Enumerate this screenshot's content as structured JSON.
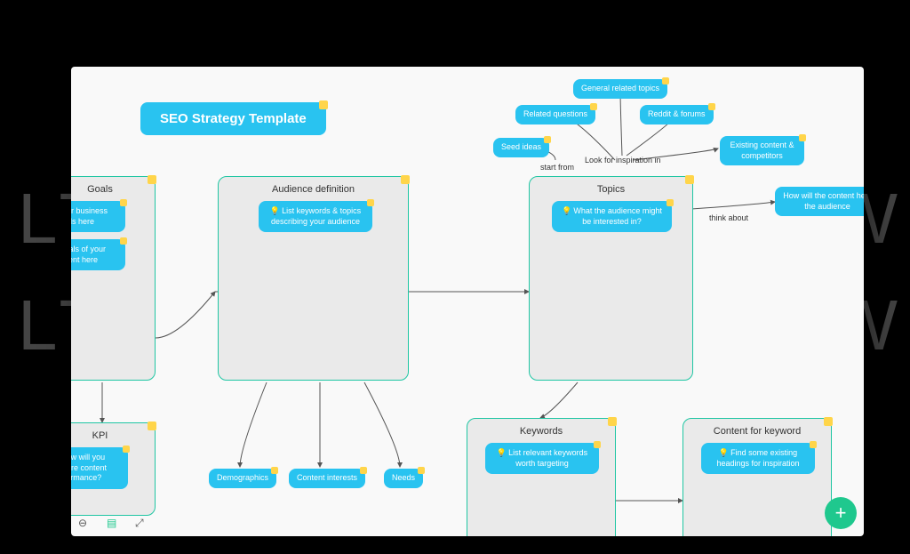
{
  "watermark_left": "LT",
  "watermark_right": "W",
  "title": "SEO Strategy Template",
  "panels": {
    "goals": {
      "title": "Goals",
      "n1": "List your business goals here",
      "n2": "List goals of your content here"
    },
    "kpi": {
      "title": "KPI",
      "n1": "How will you measure content performance?"
    },
    "audience": {
      "title": "Audience definition",
      "n1": "List keywords & topics describing your audience"
    },
    "topics": {
      "title": "Topics",
      "n1": "What the audience might be interested in?"
    },
    "keywords": {
      "title": "Keywords",
      "n1": "List relevant keywords worth targeting"
    },
    "content": {
      "title": "Content for keyword",
      "n1": "Find some existing headings for inspiration"
    }
  },
  "floating": {
    "seed": "Seed ideas",
    "related_q": "Related questions",
    "general": "General related topics",
    "reddit": "Reddit & forums",
    "existing": "Existing content & competitors",
    "help": "How will the content help the audience",
    "demo": "Demographics",
    "interests": "Content interests",
    "needs": "Needs"
  },
  "labels": {
    "start_from": "start from",
    "look_for": "Look for inspiration in",
    "think_about": "think about"
  },
  "fab": "+"
}
